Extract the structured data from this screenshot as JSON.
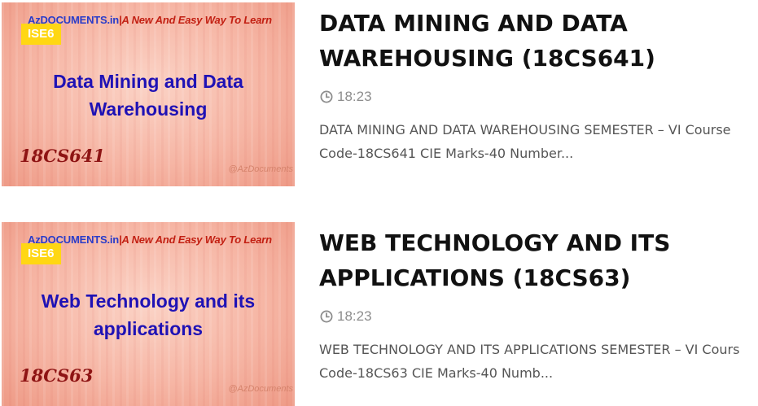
{
  "posts": [
    {
      "thumb": {
        "site": "AzDOCUMENTS.in",
        "tagline": "A New And Easy Way To Learn",
        "badge": "ISE6",
        "title_line1": "Data Mining and Data",
        "title_line2": "Warehousing",
        "code": "18CS641",
        "handle": "@AzDocuments"
      },
      "title_line1": "DATA MINING AND DATA",
      "title_line2": "WAREHOUSING (18CS641)",
      "time": "18:23",
      "excerpt_line1": "DATA MINING AND DATA WAREHOUSING SEMESTER – VI Course",
      "excerpt_line2": "Code-18CS641 CIE Marks-40 Number..."
    },
    {
      "thumb": {
        "site": "AzDOCUMENTS.in",
        "tagline": "A New And Easy Way To Learn",
        "badge": "ISE6",
        "title_line1": "Web Technology and its",
        "title_line2": "applications",
        "code": "18CS63",
        "handle": "@AzDocuments"
      },
      "title_line1": "WEB TECHNOLOGY AND ITS",
      "title_line2": "APPLICATIONS (18CS63)",
      "time": "18:23",
      "excerpt_line1": "WEB TECHNOLOGY AND ITS APPLICATIONS SEMESTER – VI Cours",
      "excerpt_line2": "Code-18CS63 CIE Marks-40 Numb..."
    }
  ],
  "colors": {
    "badge": "#ffd713",
    "thumb_title": "#1f12b5",
    "thumb_code": "#8e1414",
    "meta": "#8d8d8d"
  }
}
